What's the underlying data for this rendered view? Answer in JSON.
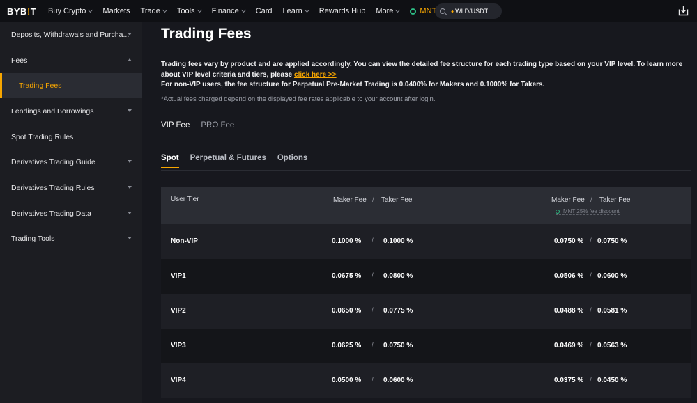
{
  "header": {
    "logo_main": "BYB",
    "logo_accent": "!",
    "logo_end": "T",
    "nav": [
      {
        "label": "Buy Crypto",
        "dropdown": true
      },
      {
        "label": "Markets",
        "dropdown": false
      },
      {
        "label": "Trade",
        "dropdown": true
      },
      {
        "label": "Tools",
        "dropdown": true
      },
      {
        "label": "Finance",
        "dropdown": true
      },
      {
        "label": "Card",
        "dropdown": false
      },
      {
        "label": "Learn",
        "dropdown": true
      },
      {
        "label": "Rewards Hub",
        "dropdown": false
      },
      {
        "label": "More",
        "dropdown": true
      }
    ],
    "mnt_label": "MNT",
    "search_value": "WLD/USDT",
    "accent_color": "#f7a600"
  },
  "sidebar": {
    "items": [
      {
        "label": "Deposits, Withdrawals and Purcha...",
        "arrow": "down"
      },
      {
        "label": "Fees",
        "arrow": "up"
      },
      {
        "label": "Trading Fees",
        "arrow": "none",
        "active": true
      },
      {
        "label": "Lendings and Borrowings",
        "arrow": "down"
      },
      {
        "label": "Spot Trading Rules",
        "arrow": "none"
      },
      {
        "label": "Derivatives Trading Guide",
        "arrow": "down"
      },
      {
        "label": "Derivatives Trading Rules",
        "arrow": "down"
      },
      {
        "label": "Derivatives Trading Data",
        "arrow": "down"
      },
      {
        "label": "Trading Tools",
        "arrow": "down"
      }
    ]
  },
  "main": {
    "title": "Trading Fees",
    "intro_1": "Trading fees vary by product and are applied accordingly. You can view the detailed fee structure for each trading type based on your VIP level. To learn more about VIP level criteria and tiers, please ",
    "intro_link": "click here >>",
    "intro_2": "For non-VIP users, the fee structure for Perpetual Pre-Market Trading is 0.0400% for Makers and 0.1000% for Takers.",
    "note": "*Actual fees charged depend on the displayed fee rates applicable to your account after login.",
    "fee_tabs": [
      "VIP Fee",
      "PRO Fee"
    ],
    "product_tabs": [
      "Spot",
      "Perpetual & Futures",
      "Options"
    ],
    "table": {
      "col_tier": "User Tier",
      "col_maker": "Maker Fee",
      "col_taker": "Taker Fee",
      "separator": "/",
      "discount_label": "MNT 25% fee discount",
      "rows": [
        {
          "tier": "Non-VIP",
          "maker": "0.1000 %",
          "taker": "0.1000 %",
          "maker_disc": "0.0750 %",
          "taker_disc": "0.0750 %"
        },
        {
          "tier": "VIP1",
          "maker": "0.0675 %",
          "taker": "0.0800 %",
          "maker_disc": "0.0506 %",
          "taker_disc": "0.0600 %"
        },
        {
          "tier": "VIP2",
          "maker": "0.0650 %",
          "taker": "0.0775 %",
          "maker_disc": "0.0488 %",
          "taker_disc": "0.0581 %"
        },
        {
          "tier": "VIP3",
          "maker": "0.0625 %",
          "taker": "0.0750 %",
          "maker_disc": "0.0469 %",
          "taker_disc": "0.0563 %"
        },
        {
          "tier": "VIP4",
          "maker": "0.0500 %",
          "taker": "0.0600 %",
          "maker_disc": "0.0375 %",
          "taker_disc": "0.0450 %"
        }
      ]
    }
  }
}
